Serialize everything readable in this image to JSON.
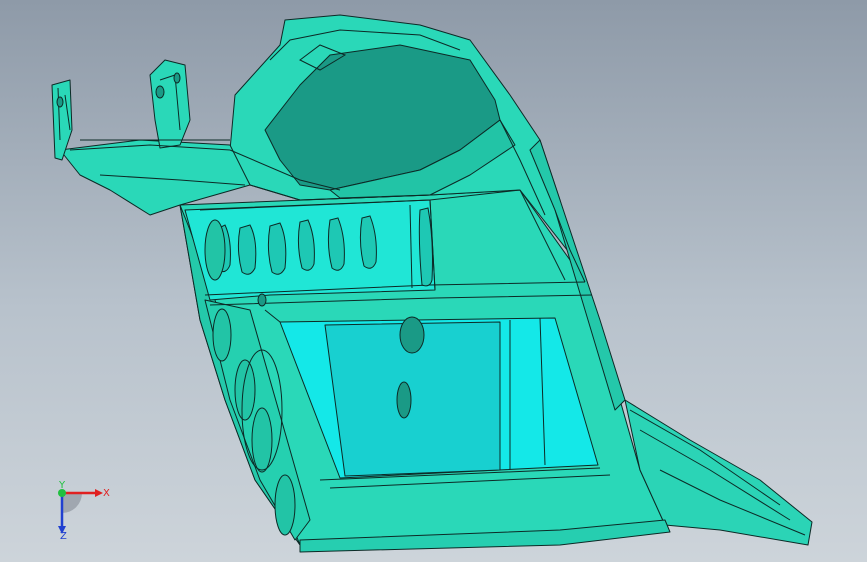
{
  "viewport": {
    "background_top": "#8e9aa8",
    "background_bottom": "#cdd4da",
    "model_color": "#2ad8b8",
    "model_shadow_color": "#1a9a86",
    "model_highlight_color": "#22f0e8",
    "edge_color": "#0c2a26"
  },
  "triad": {
    "x_label": "X",
    "y_label": "Y",
    "z_label": "Z",
    "x_color": "#e02020",
    "y_color": "#20c040",
    "z_color": "#2040d0"
  }
}
